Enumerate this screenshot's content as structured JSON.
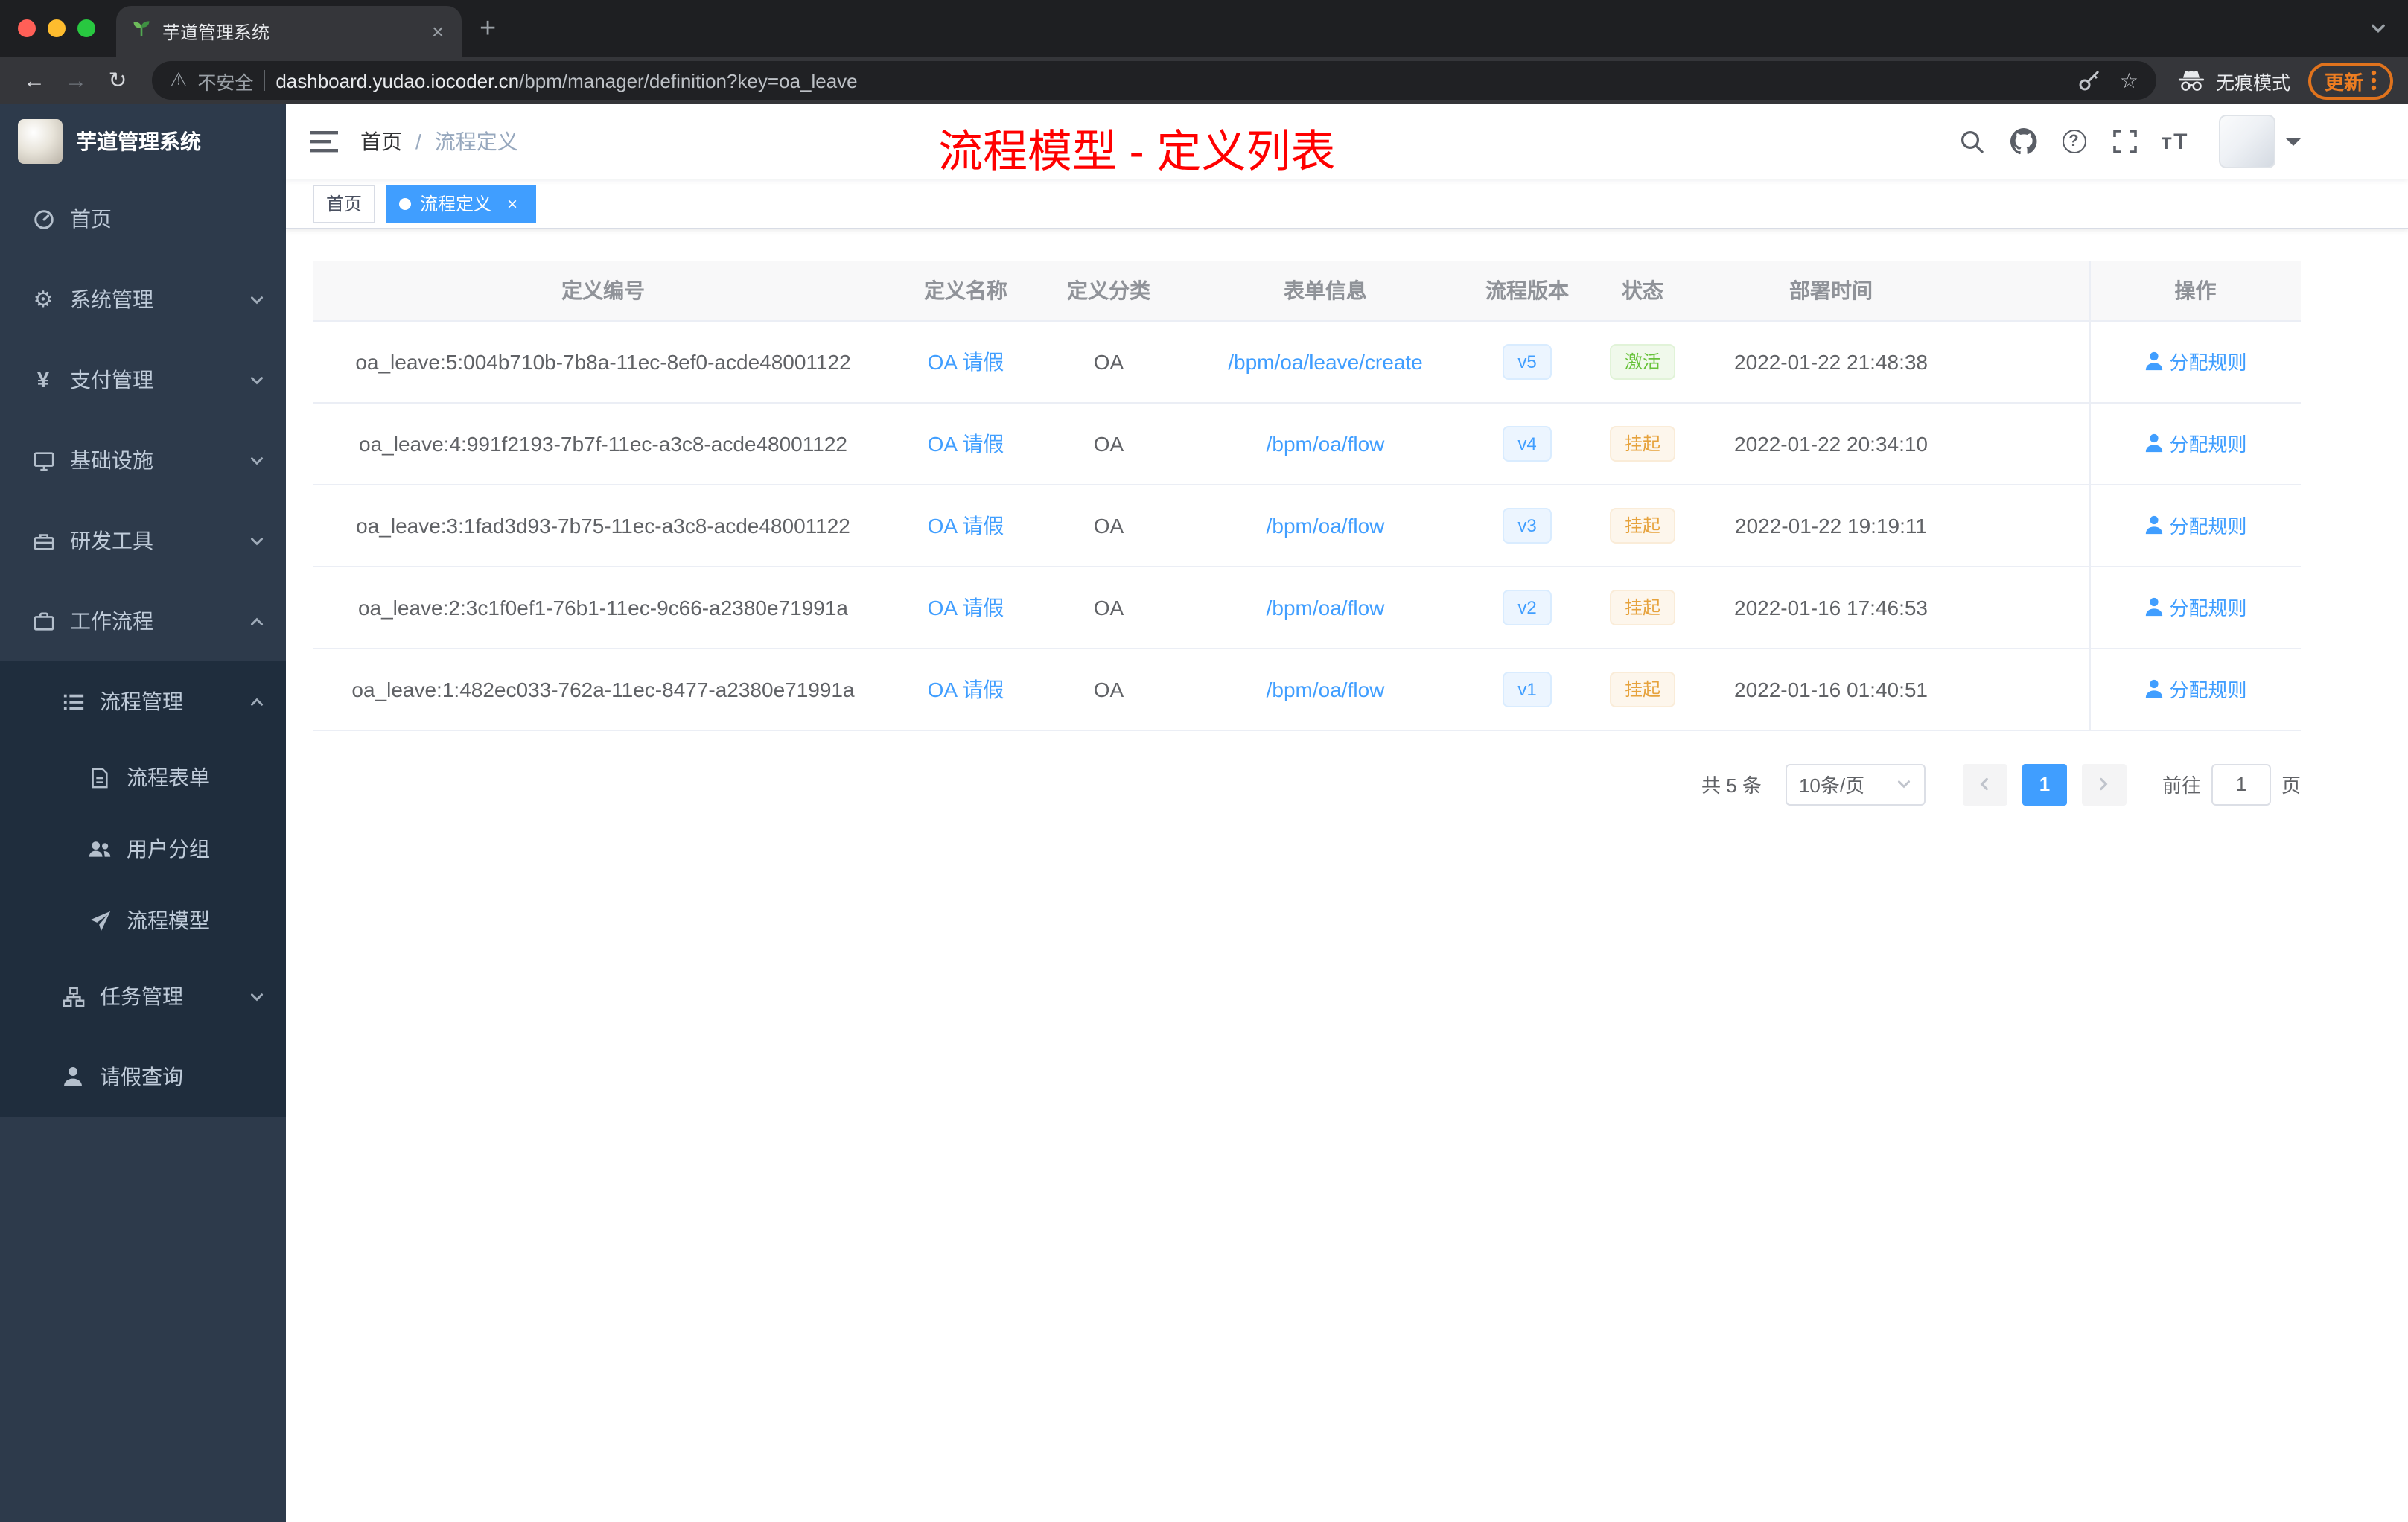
{
  "browser": {
    "tab_title": "芋道管理系统",
    "security_label": "不安全",
    "url_domain": "dashboard.yudao.iocoder.cn",
    "url_path": "/bpm/manager/definition?key=oa_leave",
    "incognito_label": "无痕模式",
    "update_label": "更新"
  },
  "icons": {
    "back": "←",
    "forward": "→",
    "reload": "↻",
    "warning": "⚠",
    "star": "☆",
    "new_tab": "+",
    "tab_close": "×",
    "tag_close": "×",
    "gear": "⚙",
    "yen": "¥",
    "question": "?",
    "font_size": "тT"
  },
  "sidebar": {
    "logo_title": "芋道管理系统",
    "items": [
      {
        "label": "首页"
      },
      {
        "label": "系统管理"
      },
      {
        "label": "支付管理"
      },
      {
        "label": "基础设施"
      },
      {
        "label": "研发工具"
      },
      {
        "label": "工作流程"
      },
      {
        "label": "流程管理"
      },
      {
        "label": "流程表单"
      },
      {
        "label": "用户分组"
      },
      {
        "label": "流程模型"
      },
      {
        "label": "任务管理"
      },
      {
        "label": "请假查询"
      }
    ]
  },
  "navbar": {
    "breadcrumb_home": "首页",
    "breadcrumb_separator": "/",
    "breadcrumb_current": "流程定义",
    "annotation": "流程模型 - 定义列表"
  },
  "tags_view": {
    "tags": [
      {
        "label": "首页"
      },
      {
        "label": "流程定义"
      }
    ]
  },
  "table": {
    "columns": [
      "定义编号",
      "定义名称",
      "定义分类",
      "表单信息",
      "流程版本",
      "状态",
      "部署时间",
      "操作"
    ],
    "action_label": "分配规则",
    "rows": [
      {
        "id": "oa_leave:5:004b710b-7b8a-11ec-8ef0-acde48001122",
        "name": "OA 请假",
        "category": "OA",
        "form": "/bpm/oa/leave/create",
        "version": "v5",
        "status": "激活",
        "status_type": "success",
        "deploy_time": "2022-01-22 21:48:38"
      },
      {
        "id": "oa_leave:4:991f2193-7b7f-11ec-a3c8-acde48001122",
        "name": "OA 请假",
        "category": "OA",
        "form": "/bpm/oa/flow",
        "version": "v4",
        "status": "挂起",
        "status_type": "warning",
        "deploy_time": "2022-01-22 20:34:10"
      },
      {
        "id": "oa_leave:3:1fad3d93-7b75-11ec-a3c8-acde48001122",
        "name": "OA 请假",
        "category": "OA",
        "form": "/bpm/oa/flow",
        "version": "v3",
        "status": "挂起",
        "status_type": "warning",
        "deploy_time": "2022-01-22 19:19:11"
      },
      {
        "id": "oa_leave:2:3c1f0ef1-76b1-11ec-9c66-a2380e71991a",
        "name": "OA 请假",
        "category": "OA",
        "form": "/bpm/oa/flow",
        "version": "v2",
        "status": "挂起",
        "status_type": "warning",
        "deploy_time": "2022-01-16 17:46:53"
      },
      {
        "id": "oa_leave:1:482ec033-762a-11ec-8477-a2380e71991a",
        "name": "OA 请假",
        "category": "OA",
        "form": "/bpm/oa/flow",
        "version": "v1",
        "status": "挂起",
        "status_type": "warning",
        "deploy_time": "2022-01-16 01:40:51"
      }
    ]
  },
  "pagination": {
    "total": "共 5 条",
    "page_size": "10条/页",
    "current_page": "1",
    "goto_label": "前往",
    "goto_value": "1",
    "page_unit": "页"
  },
  "colors": {
    "accent": "#409eff",
    "success": "#67c23a",
    "warning": "#e6a23c",
    "annotation_red": "#ff0000",
    "sidebar_bg": "#2d3a4b",
    "sidebar_sub_bg": "#1f2d3d"
  }
}
